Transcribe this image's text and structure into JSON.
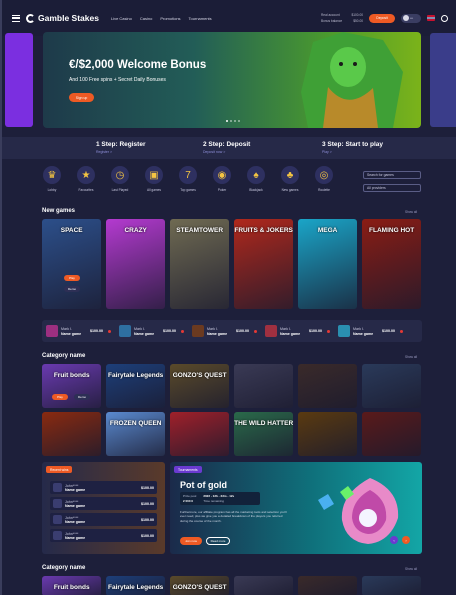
{
  "header": {
    "brand": "Gamble Stakes",
    "nav": [
      "Live Casino",
      "Casino",
      "Promotions",
      "Tournaments"
    ],
    "balances": [
      {
        "label": "Real account",
        "value": "$100.00"
      },
      {
        "label": "Bonus balance",
        "value": "$50.00"
      }
    ],
    "deposit_label": "Deposit",
    "avatar_text": "•••"
  },
  "hero": {
    "title": "€/$2,000 Welcome Bonus",
    "subtitle": "And 100 Free spins + Secret Daily Bonuses",
    "cta": "Sign up",
    "slides": 4,
    "active_slide": 1
  },
  "steps": [
    {
      "title": "1 Step: Register",
      "link": "Register >"
    },
    {
      "title": "2 Step: Deposit",
      "link": "Deposit now >"
    },
    {
      "title": "3 Step: Start to play",
      "link": "Play >"
    }
  ],
  "categories": [
    {
      "label": "Lobby",
      "icon": "crown-icon",
      "glyph": "♛"
    },
    {
      "label": "Favourites",
      "icon": "star-icon",
      "glyph": "★"
    },
    {
      "label": "Last Played",
      "icon": "clock-icon",
      "glyph": "◷"
    },
    {
      "label": "All games",
      "icon": "chest-icon",
      "glyph": "▣"
    },
    {
      "label": "Top games",
      "icon": "seven-icon",
      "glyph": "7"
    },
    {
      "label": "Poker",
      "icon": "chip-icon",
      "glyph": "◉"
    },
    {
      "label": "Blackjack",
      "icon": "spade-icon",
      "glyph": "♠"
    },
    {
      "label": "New games",
      "icon": "cherry-icon",
      "glyph": "♣"
    },
    {
      "label": "Roulette",
      "icon": "roulette-icon",
      "glyph": "◎"
    }
  ],
  "search": {
    "placeholder": "Search for games"
  },
  "providers": {
    "value": "All providers"
  },
  "new_games": {
    "title": "New games",
    "show_all": "Show all",
    "play": "Play",
    "demo": "Demo",
    "tiles": [
      {
        "name": "SPACE",
        "color": "#2c4f8a"
      },
      {
        "name": "CRAZY",
        "color": "#b43ad0"
      },
      {
        "name": "STEAMTOWER",
        "color": "#6f6a52"
      },
      {
        "name": "FRUITS & JOKERS",
        "color": "#b0281c"
      },
      {
        "name": "MEGA",
        "color": "#1aa5c8"
      },
      {
        "name": "FLAMING HOT",
        "color": "#8a1c14"
      }
    ]
  },
  "winners": [
    {
      "user": "Mark I.",
      "game": "Name game",
      "amount": "$100.00",
      "color": "#9c2f80"
    },
    {
      "user": "Mark I.",
      "game": "Name game",
      "amount": "$100.00",
      "color": "#2e6fa0"
    },
    {
      "user": "Mark I.",
      "game": "Name game",
      "amount": "$100.00",
      "color": "#6b3a20"
    },
    {
      "user": "Mark I.",
      "game": "Name game",
      "amount": "$100.00",
      "color": "#a03040"
    },
    {
      "user": "Mark I.",
      "game": "Name game",
      "amount": "$100.00",
      "color": "#2a8fb0"
    }
  ],
  "category_section": {
    "title": "Category name",
    "show_all": "Show all",
    "play": "Play",
    "demo": "Demo",
    "row1": [
      {
        "name": "Fruit bonds",
        "color": "#6a3ab0"
      },
      {
        "name": "Fairytale Legends",
        "color": "#1d3f7a"
      },
      {
        "name": "GONZO'S QUEST",
        "color": "#5a4a2a"
      },
      {
        "name": "",
        "color": "#3a3a55"
      },
      {
        "name": "",
        "color": "#3a2a2a"
      },
      {
        "name": "",
        "color": "#2a3a5a"
      }
    ],
    "row2": [
      {
        "name": "",
        "color": "#8a2a10"
      },
      {
        "name": "FROZEN QUEEN",
        "color": "#5a8ad0"
      },
      {
        "name": "",
        "color": "#a0202a"
      },
      {
        "name": "THE WILD HATTER",
        "color": "#2a6a4a"
      },
      {
        "name": "",
        "color": "#5a3a10"
      },
      {
        "name": "",
        "color": "#5a1a1a"
      }
    ]
  },
  "recent_wins": {
    "tag": "Recent wins",
    "items": [
      {
        "user": "John****",
        "game": "Name game",
        "amount": "$100.00"
      },
      {
        "user": "John****",
        "game": "Name game",
        "amount": "$100.00"
      },
      {
        "user": "John****",
        "game": "Name game",
        "amount": "$100.00"
      },
      {
        "user": "John****",
        "game": "Name game",
        "amount": "$100.00"
      }
    ]
  },
  "tournament": {
    "tag": "Tournaments",
    "title": "Pot of gold",
    "prize_label": "Prize pool",
    "prize_value": "2 000 €",
    "dates": "2022 - 12h - 23m - 12s",
    "status": "Time remaining",
    "description": "Furthermore, our affiliate program has all the marketing tools and selection you'll ever need, plus we give you a detailed breakdown of the players you referred during the course of the month.",
    "join": "Join now",
    "more": "Read more"
  },
  "category_section2": {
    "title": "Category name",
    "show_all": "Show all"
  }
}
